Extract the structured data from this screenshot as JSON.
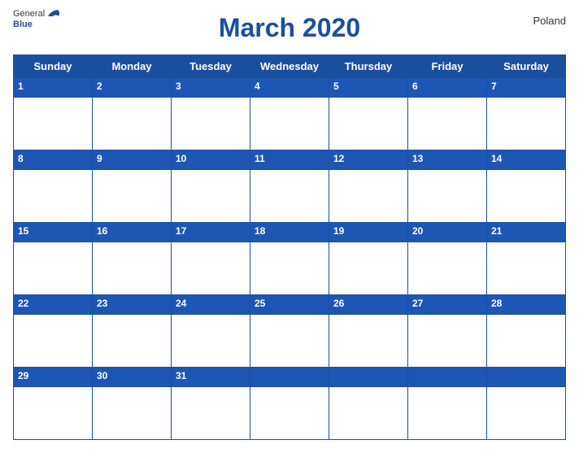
{
  "header": {
    "title": "March 2020",
    "country": "Poland",
    "logo_general": "General",
    "logo_blue": "Blue"
  },
  "weekdays": [
    "Sunday",
    "Monday",
    "Tuesday",
    "Wednesday",
    "Thursday",
    "Friday",
    "Saturday"
  ],
  "weeks": [
    {
      "days": [
        1,
        2,
        3,
        4,
        5,
        6,
        7
      ]
    },
    {
      "days": [
        8,
        9,
        10,
        11,
        12,
        13,
        14
      ]
    },
    {
      "days": [
        15,
        16,
        17,
        18,
        19,
        20,
        21
      ]
    },
    {
      "days": [
        22,
        23,
        24,
        25,
        26,
        27,
        28
      ]
    },
    {
      "days": [
        29,
        30,
        31,
        null,
        null,
        null,
        null
      ]
    }
  ]
}
